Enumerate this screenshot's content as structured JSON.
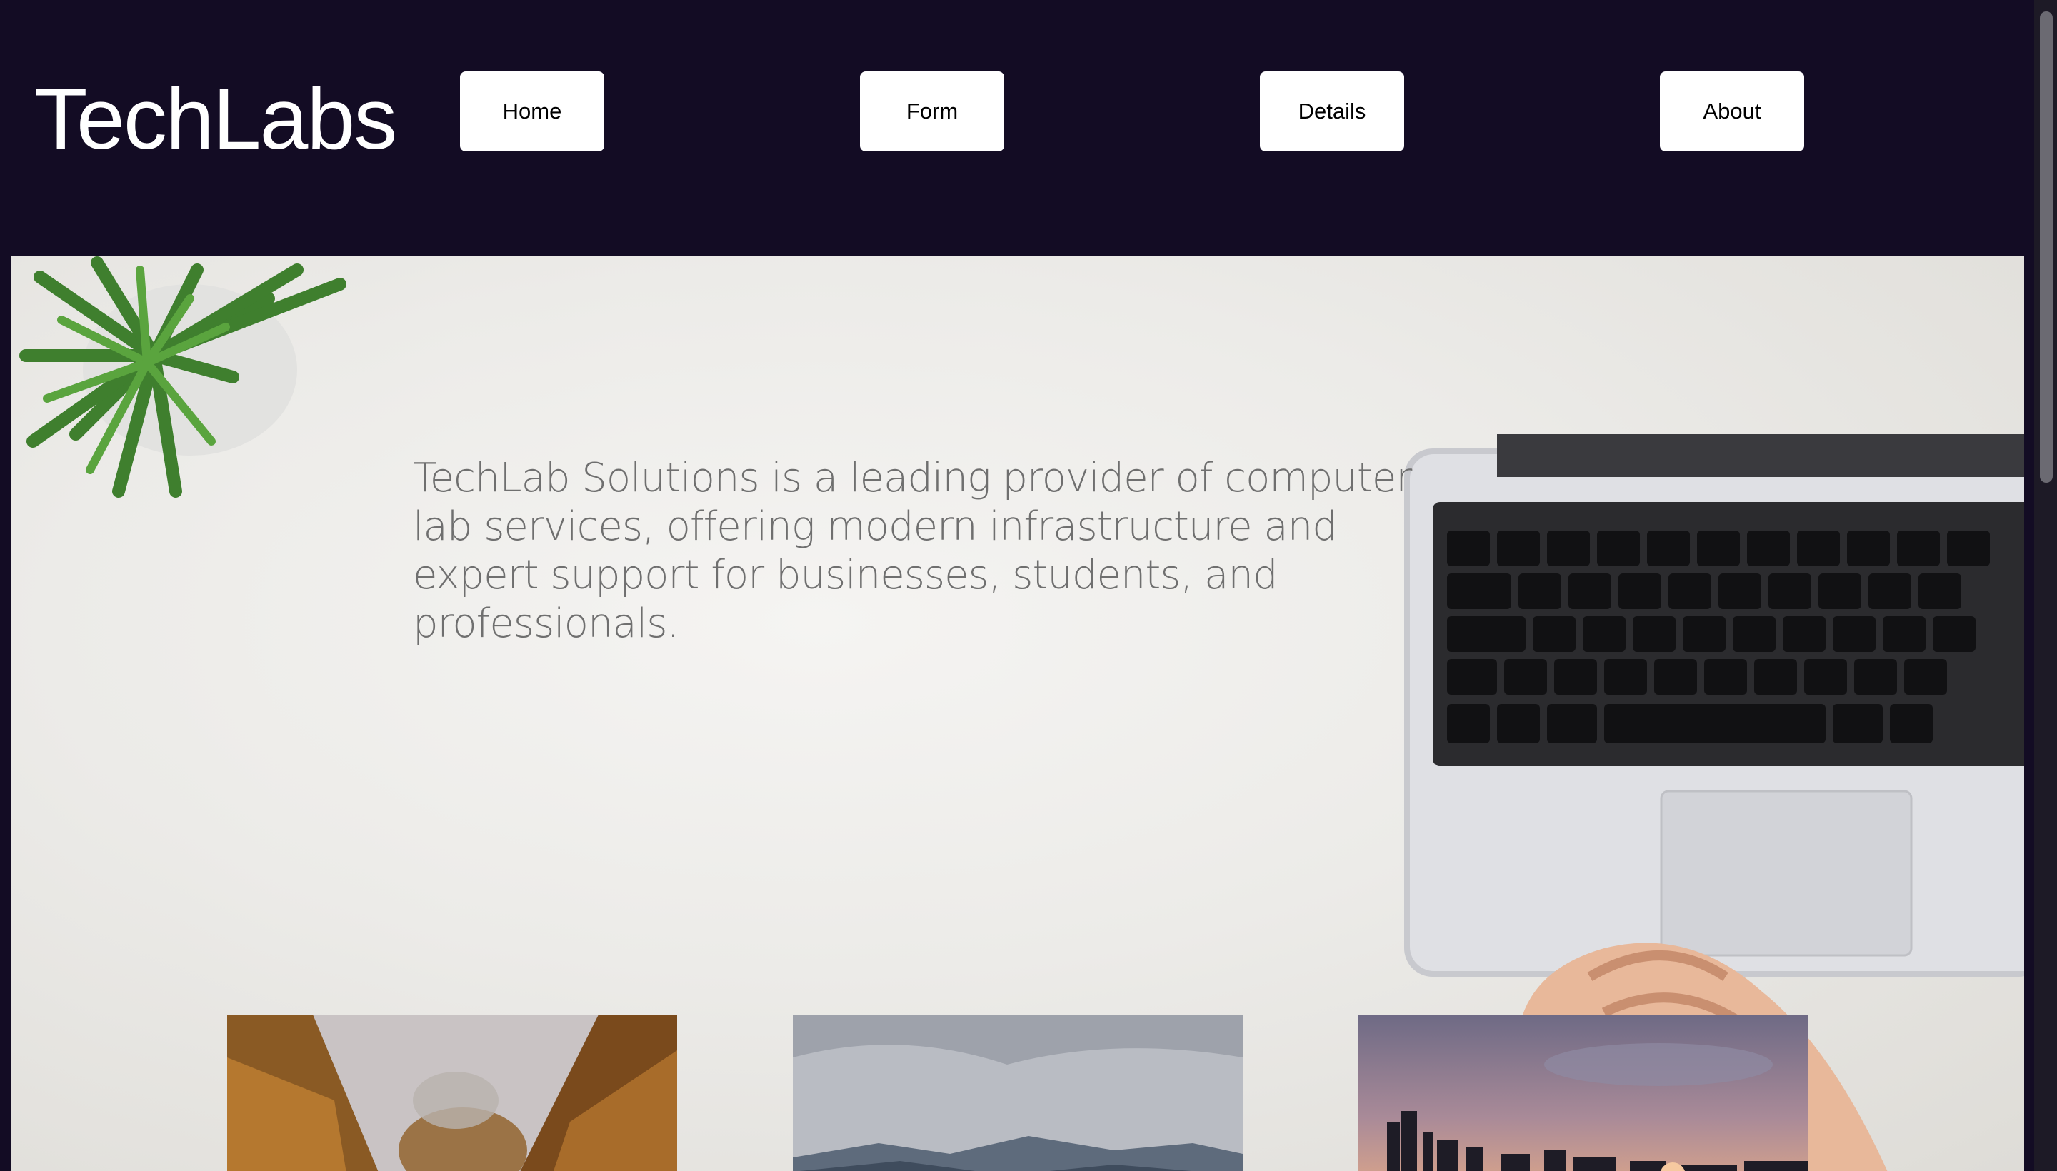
{
  "header": {
    "logo": "TechLabs",
    "nav": [
      {
        "label": "Home"
      },
      {
        "label": "Form"
      },
      {
        "label": "Details"
      },
      {
        "label": "About"
      }
    ]
  },
  "hero": {
    "text": "TechLab Solutions is a leading provider of computer lab services, offering modern infrastructure and expert support for businesses, students, and professionals."
  },
  "gallery": [
    {
      "image": "autumn-forest-path-photo"
    },
    {
      "image": "misty-mountains-photo"
    },
    {
      "image": "city-skyline-sunset-photo"
    }
  ],
  "colors": {
    "header_bg": "#130c24",
    "button_bg": "#ffffff",
    "hero_text": "#6f6f6f"
  }
}
